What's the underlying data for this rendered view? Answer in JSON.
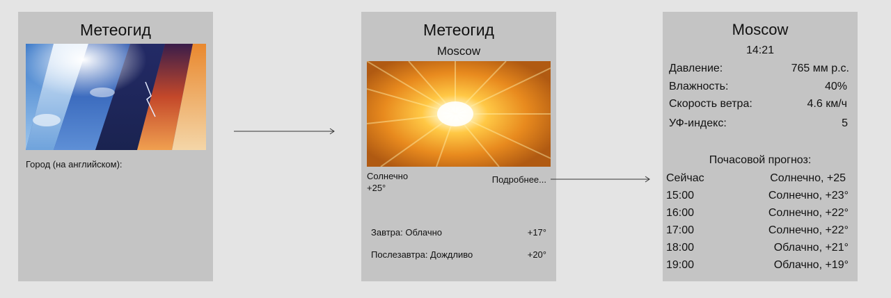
{
  "screen1": {
    "title": "Метеогид",
    "city_label": "Город (на английском):",
    "image_icon": "weather-collage-image"
  },
  "screen2": {
    "title": "Метеогид",
    "city": "Moscow",
    "image_icon": "sun-image",
    "condition": "Солнечно",
    "temperature": "+25°",
    "details_link": "Подробнее...",
    "tomorrow": {
      "label": "Завтра: Облачно",
      "temp": "+17°"
    },
    "after_tomorrow": {
      "label": "Послезавтра: Дождливо",
      "temp": "+20°"
    }
  },
  "screen3": {
    "city": "Moscow",
    "time": "14:21",
    "stats": [
      {
        "label": "Давление:",
        "value": "765 мм р.с."
      },
      {
        "label": "Влажность:",
        "value": "40%"
      },
      {
        "label": "Скорость ветра:",
        "value": "4.6 км/ч"
      },
      {
        "label": "УФ-индекс:",
        "value": "5"
      }
    ],
    "hourly_title": "Почасовой прогноз:",
    "hourly": [
      {
        "time": "Сейчас",
        "forecast": "Солнечно, +25"
      },
      {
        "time": "15:00",
        "forecast": "Солнечно, +23°"
      },
      {
        "time": "16:00",
        "forecast": "Солнечно, +22°"
      },
      {
        "time": "17:00",
        "forecast": "Солнечно, +22°"
      },
      {
        "time": "18:00",
        "forecast": "Облачно, +21°"
      },
      {
        "time": "19:00",
        "forecast": "Облачно, +19°"
      }
    ]
  },
  "colors": {
    "screen_bg": "#c4c4c4",
    "canvas_bg": "#e4e4e4",
    "arrow": "#333333"
  }
}
